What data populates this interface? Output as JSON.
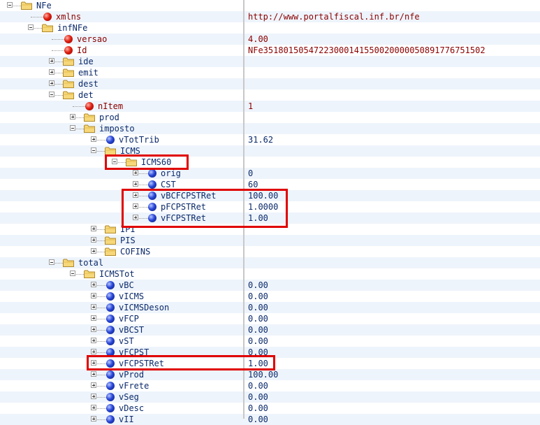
{
  "tree": {
    "rows": [
      {
        "label": "NFe",
        "kind": "folder",
        "expander": "minus",
        "value": ""
      },
      {
        "label": "xmlns",
        "kind": "attr",
        "expander": "",
        "value": "http://www.portalfiscal.inf.br/nfe"
      },
      {
        "label": "infNFe",
        "kind": "folder",
        "expander": "minus",
        "value": ""
      },
      {
        "label": "versao",
        "kind": "attr",
        "expander": "",
        "value": "4.00"
      },
      {
        "label": "Id",
        "kind": "attr",
        "expander": "",
        "value": "NFe35180150547223000141550020000050891776751502"
      },
      {
        "label": "ide",
        "kind": "folder",
        "expander": "plus",
        "value": ""
      },
      {
        "label": "emit",
        "kind": "folder",
        "expander": "plus",
        "value": ""
      },
      {
        "label": "dest",
        "kind": "folder",
        "expander": "plus",
        "value": ""
      },
      {
        "label": "det",
        "kind": "folder",
        "expander": "minus",
        "value": ""
      },
      {
        "label": "nItem",
        "kind": "attr",
        "expander": "",
        "value": "1"
      },
      {
        "label": "prod",
        "kind": "folder",
        "expander": "plus",
        "value": ""
      },
      {
        "label": "imposto",
        "kind": "folder",
        "expander": "minus",
        "value": ""
      },
      {
        "label": "vTotTrib",
        "kind": "elem",
        "expander": "plus",
        "value": "31.62"
      },
      {
        "label": "ICMS",
        "kind": "folder",
        "expander": "minus",
        "value": ""
      },
      {
        "label": "ICMS60",
        "kind": "folder",
        "expander": "minus",
        "value": ""
      },
      {
        "label": "orig",
        "kind": "elem",
        "expander": "plus",
        "value": "0"
      },
      {
        "label": "CST",
        "kind": "elem",
        "expander": "plus",
        "value": "60"
      },
      {
        "label": "vBCFCPSTRet",
        "kind": "elem",
        "expander": "plus",
        "value": "100.00"
      },
      {
        "label": "pFCPSTRet",
        "kind": "elem",
        "expander": "plus",
        "value": "1.0000"
      },
      {
        "label": "vFCPSTRet",
        "kind": "elem",
        "expander": "plus",
        "value": "1.00"
      },
      {
        "label": "IPI",
        "kind": "folder",
        "expander": "plus",
        "value": ""
      },
      {
        "label": "PIS",
        "kind": "folder",
        "expander": "plus",
        "value": ""
      },
      {
        "label": "COFINS",
        "kind": "folder",
        "expander": "plus",
        "value": ""
      },
      {
        "label": "total",
        "kind": "folder",
        "expander": "minus",
        "value": ""
      },
      {
        "label": "ICMSTot",
        "kind": "folder",
        "expander": "minus",
        "value": ""
      },
      {
        "label": "vBC",
        "kind": "elem",
        "expander": "plus",
        "value": "0.00"
      },
      {
        "label": "vICMS",
        "kind": "elem",
        "expander": "plus",
        "value": "0.00"
      },
      {
        "label": "vICMSDeson",
        "kind": "elem",
        "expander": "plus",
        "value": "0.00"
      },
      {
        "label": "vFCP",
        "kind": "elem",
        "expander": "plus",
        "value": "0.00"
      },
      {
        "label": "vBCST",
        "kind": "elem",
        "expander": "plus",
        "value": "0.00"
      },
      {
        "label": "vST",
        "kind": "elem",
        "expander": "plus",
        "value": "0.00"
      },
      {
        "label": "vFCPST",
        "kind": "elem",
        "expander": "plus",
        "value": "0.00"
      },
      {
        "label": "vFCPSTRet",
        "kind": "elem",
        "expander": "plus",
        "value": "1.00"
      },
      {
        "label": "vProd",
        "kind": "elem",
        "expander": "plus",
        "value": "100.00"
      },
      {
        "label": "vFrete",
        "kind": "elem",
        "expander": "plus",
        "value": "0.00"
      },
      {
        "label": "vSeg",
        "kind": "elem",
        "expander": "plus",
        "value": "0.00"
      },
      {
        "label": "vDesc",
        "kind": "elem",
        "expander": "plus",
        "value": "0.00"
      },
      {
        "label": "vII",
        "kind": "elem",
        "expander": "plus",
        "value": "0.00"
      }
    ]
  },
  "colors": {
    "highlight": "#e00000",
    "attribute_text": "#8b0000",
    "element_text": "#0b2a6b",
    "row_stripe": "#eef4fb"
  }
}
